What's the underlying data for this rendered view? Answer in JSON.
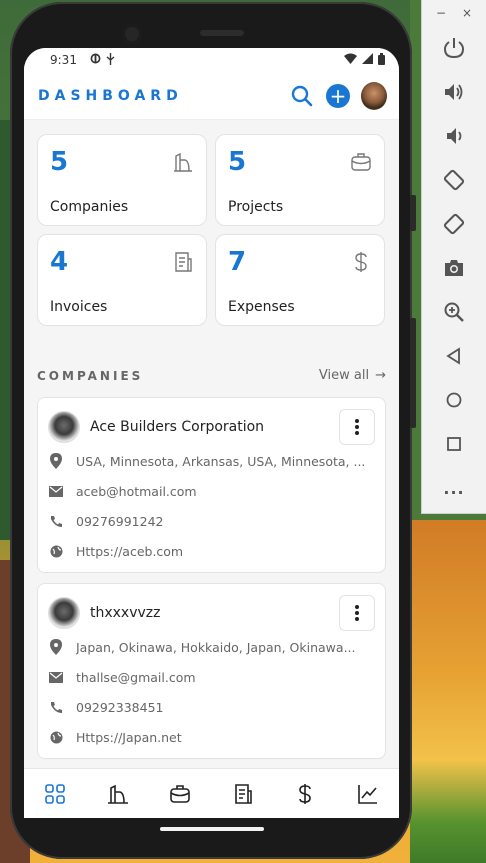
{
  "status_bar": {
    "time": "9:31"
  },
  "appbar": {
    "title": "DASHBOARD"
  },
  "stats": [
    {
      "value": "5",
      "label": "Companies",
      "icon": "building-icon"
    },
    {
      "value": "5",
      "label": "Projects",
      "icon": "briefcase-icon"
    },
    {
      "value": "4",
      "label": "Invoices",
      "icon": "invoice-icon"
    },
    {
      "value": "7",
      "label": "Expenses",
      "icon": "dollar-icon"
    }
  ],
  "companies_section": {
    "title": "COMPANIES",
    "view_all": "View all"
  },
  "companies": [
    {
      "name": "Ace Builders Corporation",
      "address": "USA, Minnesota, Arkansas, USA, Minnesota, ...",
      "email": "aceb@hotmail.com",
      "phone": "09276991242",
      "website": "Https://aceb.com"
    },
    {
      "name": "thxxxvvzz",
      "address": "Japan, Okinawa, Hokkaido, Japan, Okinawa...",
      "email": "thallse@gmail.com",
      "phone": "09292338451",
      "website": "Https://Japan.net"
    }
  ],
  "emulator": {
    "minimize": "−",
    "close": "×",
    "more": "..."
  },
  "colors": {
    "accent": "#1976d2",
    "text": "#222222",
    "muted": "#666666"
  }
}
